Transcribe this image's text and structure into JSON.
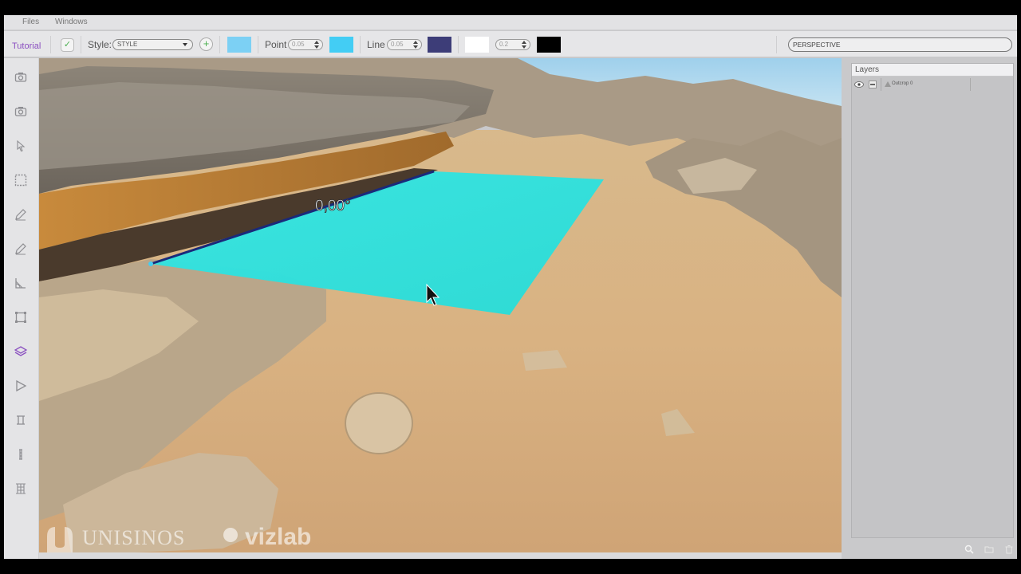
{
  "menubar": {
    "items": [
      "Files",
      "Windows"
    ]
  },
  "toolbar": {
    "tutorial_label": "Tutorial",
    "style_label": "Style:",
    "style_value": "STYLE",
    "fill_color": "#7cd0f4",
    "point_label": "Point",
    "point_size": "0.05",
    "point_color": "#43cdf4",
    "line_label": "Line",
    "line_size": "0.05",
    "line_color": "#3d3d78",
    "text_color": "#ffffff",
    "text_size": "0.2",
    "outline_color": "#000000",
    "view_mode": "PERSPECTIVE"
  },
  "sidebar": {
    "tools": [
      "camera-icon",
      "camera-icon",
      "select-arrow-icon",
      "rectangle-select-icon",
      "pencil-icon",
      "pencil-icon",
      "angle-ruler-icon",
      "bounding-box-icon",
      "layers-icon",
      "play-icon",
      "measure-icon",
      "column-icon",
      "grid-icon"
    ],
    "active_tool": "layers-icon",
    "active_color": "#8a4fc0"
  },
  "viewport": {
    "angle_label": "0,00°",
    "plane_color": "#2ee6e2",
    "watermark_left": "UNISINOS",
    "watermark_right": "vizlab"
  },
  "layers_panel": {
    "title": "Layers",
    "items": [
      {
        "name": "Outcrop 0",
        "visible": true
      }
    ]
  }
}
